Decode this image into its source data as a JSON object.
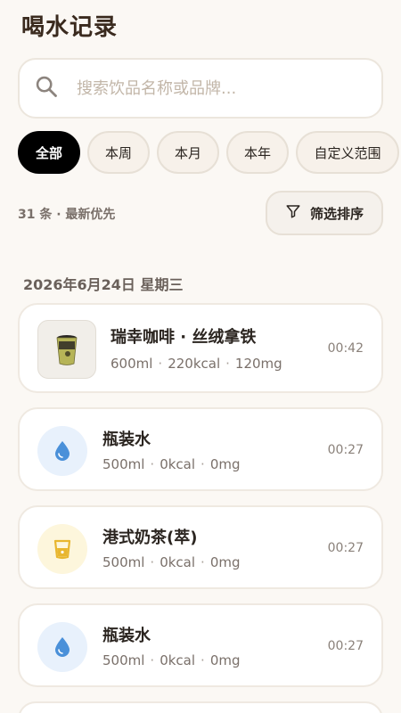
{
  "header": {
    "title": "喝水记录"
  },
  "search": {
    "placeholder": "搜索饮品名称或品牌..."
  },
  "filters": {
    "chips": [
      "全部",
      "本周",
      "本月",
      "本年",
      "自定义范围"
    ],
    "active_index": 0
  },
  "summary": {
    "text": "31 条 · 最新优先",
    "filter_button_label": "筛选排序"
  },
  "groups": [
    {
      "date": "2026年6月24日 星期三",
      "records": [
        {
          "name": "瑞幸咖啡 · 丝绒拿铁",
          "volume": "600ml",
          "calories": "220kcal",
          "caffeine": "120mg",
          "time": "00:42",
          "icon": "coffee-cup-photo"
        },
        {
          "name": "瓶装水",
          "volume": "500ml",
          "calories": "0kcal",
          "caffeine": "0mg",
          "time": "00:27",
          "icon": "water-drop-icon",
          "icon_color": "#4a90d9",
          "icon_bg": "#e8f1fc"
        },
        {
          "name": "港式奶茶(萃)",
          "volume": "500ml",
          "calories": "0kcal",
          "caffeine": "0mg",
          "time": "00:27",
          "icon": "tea-cup-icon",
          "icon_color": "#e8b62e",
          "icon_bg": "#fdf6dc"
        },
        {
          "name": "瓶装水",
          "volume": "500ml",
          "calories": "0kcal",
          "caffeine": "0mg",
          "time": "00:27",
          "icon": "water-drop-icon",
          "icon_color": "#4a90d9",
          "icon_bg": "#e8f1fc"
        }
      ]
    }
  ]
}
